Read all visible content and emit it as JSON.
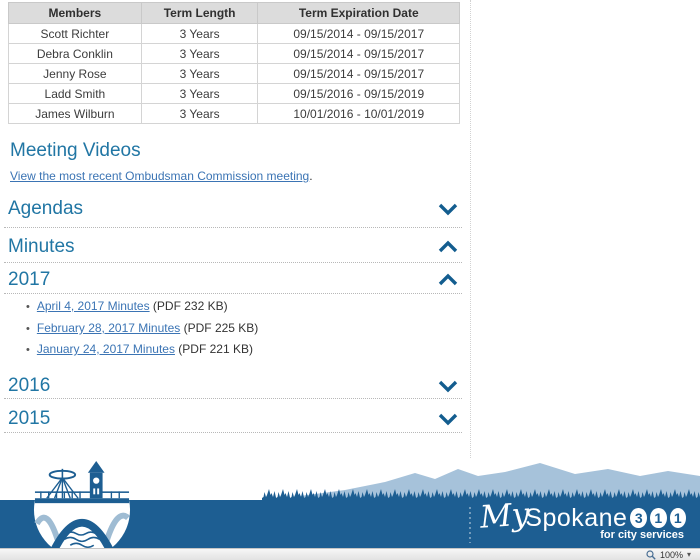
{
  "table": {
    "headers": [
      "Members",
      "Term Length",
      "Term Expiration Date"
    ],
    "rows": [
      [
        "Scott Richter",
        "3 Years",
        "09/15/2014 - 09/15/2017"
      ],
      [
        "Debra Conklin",
        "3 Years",
        "09/15/2014 - 09/15/2017"
      ],
      [
        "Jenny Rose",
        "3 Years",
        "09/15/2014 - 09/15/2017"
      ],
      [
        "Ladd Smith",
        "3 Years",
        "09/15/2016 - 09/15/2019"
      ],
      [
        "James Wilburn",
        "3 Years",
        "10/01/2016 - 10/01/2019"
      ]
    ]
  },
  "meeting_videos": {
    "heading": "Meeting Videos",
    "link_text": "View the most recent Ombudsman Commission meeting",
    "suffix": "."
  },
  "accordions": {
    "agendas": {
      "title": "Agendas",
      "state": "collapsed"
    },
    "minutes": {
      "title": "Minutes",
      "state": "expanded"
    },
    "y2017": {
      "title": "2017",
      "state": "expanded"
    },
    "y2016": {
      "title": "2016",
      "state": "collapsed"
    },
    "y2015": {
      "title": "2015",
      "state": "collapsed"
    }
  },
  "minutes_2017_items": [
    {
      "link": "April 4, 2017 Minutes",
      "meta": " (PDF 232 KB)"
    },
    {
      "link": "February 28, 2017 Minutes",
      "meta": " (PDF 225 KB)"
    },
    {
      "link": "January 24, 2017 Minutes",
      "meta": " (PDF 221 KB)"
    }
  ],
  "footer": {
    "brand_my": "My",
    "brand_spokane": "Spokane",
    "digits": [
      "3",
      "1",
      "1"
    ],
    "tagline": "for city services"
  },
  "statusbar": {
    "zoom": "100%"
  },
  "colors": {
    "heading_teal": "#2176a4",
    "link_blue": "#3b74b4",
    "chevron_blue": "#135d8f",
    "footer_dark_blue": "#1d5e92",
    "footer_light_blue": "#a6c2da",
    "table_header_bg": "#dcdcdc"
  }
}
